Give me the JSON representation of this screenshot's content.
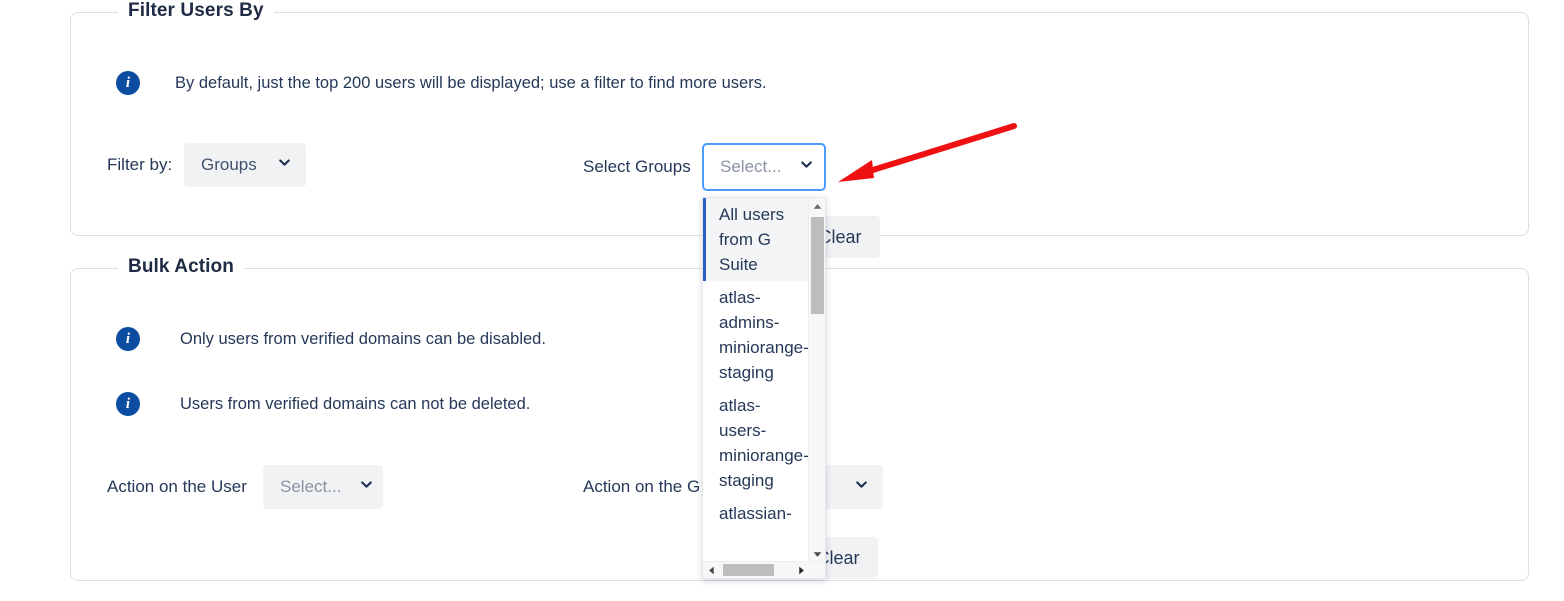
{
  "filter_section": {
    "legend": "Filter Users By",
    "info": {
      "icon": "info-icon",
      "text": "By default, just the top 200 users will be displayed; use a filter to find more users."
    },
    "filter_by": {
      "label": "Filter by:",
      "value": "Groups",
      "chevron": "chevron-down-icon"
    },
    "select_groups": {
      "label": "Select Groups",
      "placeholder": "Select...",
      "chevron": "chevron-down-icon"
    },
    "clear_label": "Clear"
  },
  "dropdown": {
    "options": [
      {
        "label": "All users from G Suite",
        "selected": true
      },
      {
        "label": "atlas-admins-miniorange-staging",
        "selected": false
      },
      {
        "label": "atlas-users-miniorange-staging",
        "selected": false
      },
      {
        "label": "atlassian-",
        "selected": false
      }
    ],
    "vertical_scrollbar": {
      "up": "scroll-up-arrow-icon",
      "down": "scroll-down-arrow-icon"
    },
    "horizontal_scrollbar": {
      "left": "scroll-left-arrow-icon",
      "right": "scroll-right-arrow-icon"
    }
  },
  "bulk_section": {
    "legend": "Bulk Action",
    "info_1": {
      "icon": "info-icon",
      "text": "Only users from verified domains can be disabled."
    },
    "info_2": {
      "icon": "info-icon",
      "text": "Users from verified domains can not be deleted."
    },
    "action_user": {
      "label": "Action on the User",
      "placeholder": "Select...",
      "chevron": "chevron-down-icon"
    },
    "action_group": {
      "label": "Action on the G",
      "placeholder": "",
      "chevron": "chevron-down-icon"
    },
    "clear_label": "Clear"
  },
  "annotation": {
    "type": "red-arrow",
    "color": "#ef1111",
    "points_to": "select-groups-dropdown"
  },
  "colors": {
    "accent_blue": "#4c9aff",
    "info_blue": "#0c4da2",
    "text": "#253858",
    "border": "#dcdfe4",
    "control_bg": "#f1f2f4",
    "annotation_red": "#ef1111"
  }
}
